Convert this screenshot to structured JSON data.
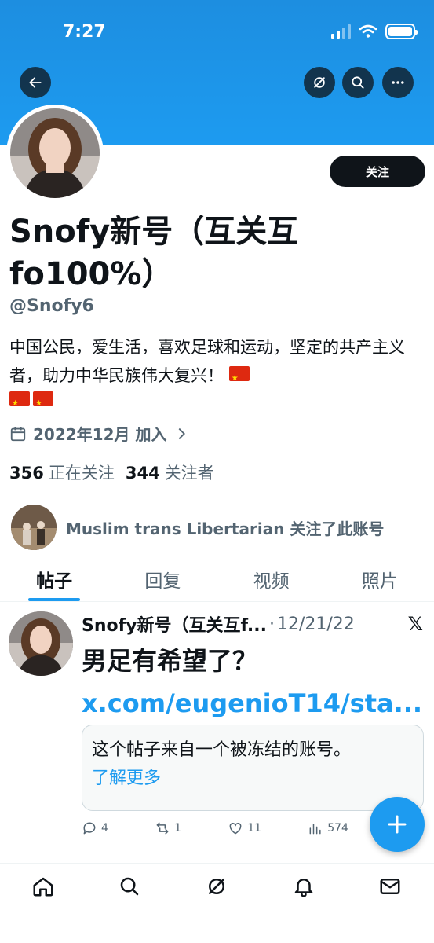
{
  "status_bar": {
    "time": "7:27"
  },
  "profile": {
    "follow_label": "关注",
    "display_name": "Snofy新号（互关互fo100%）",
    "handle": "@Snofy6",
    "bio": "中国公民，爱生活，喜欢足球和运动，坚定的共产主义者，助力中华民族伟大复兴！",
    "bio_flags": [
      "🇨🇳",
      "🇨🇳",
      "🇨🇳"
    ],
    "joined": "2022年12月 加入",
    "following_count": "356",
    "following_label": "正在关注",
    "followers_count": "344",
    "followers_label": "关注者",
    "followed_by": {
      "name": "Muslim trans Libertarian",
      "suffix": "关注了此账号"
    }
  },
  "tabs": [
    {
      "label": "帖子",
      "active": true
    },
    {
      "label": "回复",
      "active": false
    },
    {
      "label": "视频",
      "active": false
    },
    {
      "label": "照片",
      "active": false
    }
  ],
  "tweet": {
    "name": "Snofy新号（互关互f...",
    "dot": "·",
    "date": "12/21/22",
    "text": "男足有希望了？",
    "link": "x.com/eugenioT14/sta...",
    "notice": "这个帖子来自一个被冻结的账号。",
    "notice_link": "了解更多",
    "replies": "4",
    "retweets": "1",
    "likes": "11",
    "views": "574"
  },
  "icons": {
    "back": "arrow-left-icon",
    "grok": "grok-icon",
    "search": "search-icon",
    "more": "more-icon",
    "calendar": "calendar-icon",
    "chevron": "chevron-right-icon"
  },
  "colors": {
    "banner": "#1d9bf0",
    "accent": "#1d9bf0",
    "text": "#0f1419",
    "muted": "#536471"
  }
}
